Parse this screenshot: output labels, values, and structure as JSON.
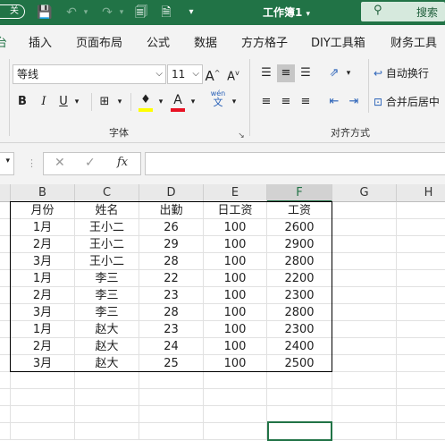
{
  "titlebar": {
    "autosave": "关",
    "doc_title": "工作簿1",
    "search_label": "搜索"
  },
  "tabs": [
    "台",
    "插入",
    "页面布局",
    "公式",
    "数据",
    "方方格子",
    "DIY工具箱",
    "财务工具"
  ],
  "ribbon": {
    "font_name": "等线",
    "font_size": "11",
    "bold": "B",
    "italic": "I",
    "underline": "U",
    "phonetic_top": "wén",
    "phonetic_bottom": "文",
    "wrap_text": "自动换行",
    "merge_center": "合并后居中",
    "font_group_label": "字体",
    "alignment_group_label": "对齐方式",
    "increase_font": "A",
    "decrease_font": "A"
  },
  "formulabar": {
    "fx": "fx"
  },
  "columns": [
    "B",
    "C",
    "D",
    "E",
    "F",
    "G",
    "H"
  ],
  "selected_column": "F",
  "table": {
    "headers": [
      "月份",
      "姓名",
      "出勤",
      "日工资",
      "工资"
    ],
    "rows": [
      [
        "1月",
        "王小二",
        "26",
        "100",
        "2600"
      ],
      [
        "2月",
        "王小二",
        "29",
        "100",
        "2900"
      ],
      [
        "3月",
        "王小二",
        "28",
        "100",
        "2800"
      ],
      [
        "1月",
        "李三",
        "22",
        "100",
        "2200"
      ],
      [
        "2月",
        "李三",
        "23",
        "100",
        "2300"
      ],
      [
        "3月",
        "李三",
        "28",
        "100",
        "2800"
      ],
      [
        "1月",
        "赵大",
        "23",
        "100",
        "2300"
      ],
      [
        "2月",
        "赵大",
        "24",
        "100",
        "2400"
      ],
      [
        "3月",
        "赵大",
        "25",
        "100",
        "2500"
      ]
    ]
  },
  "colors": {
    "accent": "#217346",
    "font_color_bar": "#e81123",
    "highlight_bar": "#ffff00"
  }
}
